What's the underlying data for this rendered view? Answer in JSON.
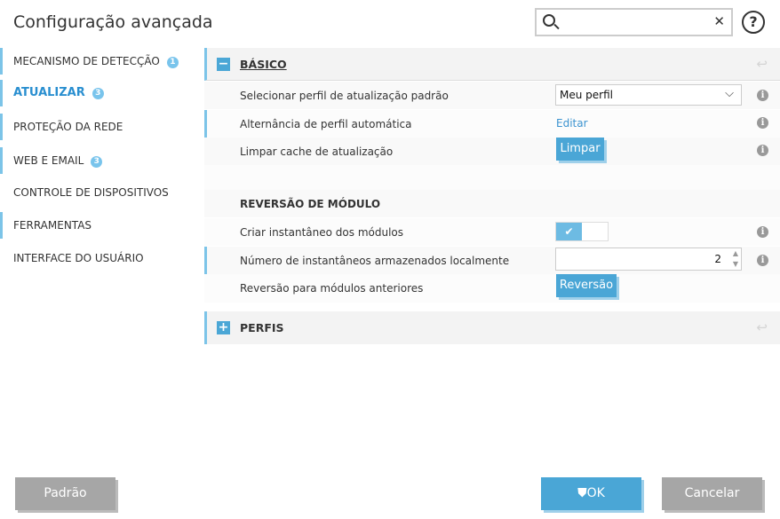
{
  "title": "Configuração avançada",
  "search": {
    "value": "",
    "clear_icon": "✕"
  },
  "help_label": "?",
  "sidebar": [
    {
      "label": "MECANISMO DE DETECÇÃO",
      "badge": "1"
    },
    {
      "label": "ATUALIZAR",
      "badge": "3"
    },
    {
      "label": "PROTEÇÃO DA REDE"
    },
    {
      "label": "WEB E EMAIL",
      "badge": "3"
    },
    {
      "label": "CONTROLE DE DISPOSITIVOS"
    },
    {
      "label": "FERRAMENTAS"
    },
    {
      "label": "INTERFACE DO USUÁRIO"
    }
  ],
  "basic": {
    "title": "BÁSICO",
    "toggle": "−",
    "rows": [
      {
        "label": "Selecionar perfil de atualização padrão",
        "value": "Meu perfil"
      },
      {
        "label": "Alternância de perfil automática",
        "link": "Editar"
      },
      {
        "label": "Limpar cache de atualização",
        "button": "Limpar"
      }
    ]
  },
  "rollback": {
    "title": "REVERSÃO DE MÓDULO",
    "rows": [
      {
        "label": "Criar instantâneo dos módulos",
        "checked": true
      },
      {
        "label": "Número de instantâneos armazenados localmente",
        "value": "2"
      },
      {
        "label": "Reversão para módulos anteriores",
        "button": "Reversão"
      }
    ]
  },
  "profiles": {
    "title": "PERFIS",
    "toggle": "+"
  },
  "footer": {
    "default": "Padrão",
    "ok": "OK",
    "cancel": "Cancelar"
  }
}
